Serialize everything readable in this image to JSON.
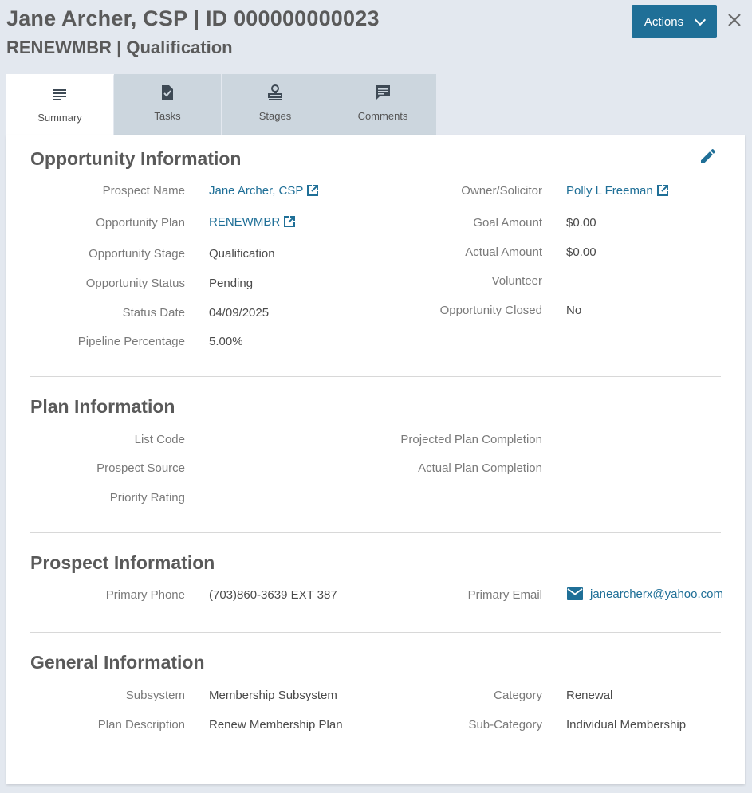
{
  "header": {
    "title": "Jane Archer, CSP | ID 000000000023",
    "subtitle": "RENEWMBR | Qualification",
    "actions_label": "Actions",
    "close_icon": "close-icon"
  },
  "tabs": [
    {
      "label": "Summary",
      "icon": "list-icon",
      "active": true
    },
    {
      "label": "Tasks",
      "icon": "task-check-icon",
      "active": false
    },
    {
      "label": "Stages",
      "icon": "stamp-icon",
      "active": false
    },
    {
      "label": "Comments",
      "icon": "comment-icon",
      "active": false
    }
  ],
  "opportunity": {
    "title": "Opportunity Information",
    "edit_icon": "pencil-icon",
    "left": [
      {
        "label": "Prospect Name",
        "value": "Jane Archer, CSP",
        "link": true
      },
      {
        "label": "Opportunity Plan",
        "value": "RENEWMBR",
        "link": true
      },
      {
        "label": "Opportunity Stage",
        "value": "Qualification"
      },
      {
        "label": "Opportunity Status",
        "value": "Pending"
      },
      {
        "label": "Status Date",
        "value": "04/09/2025"
      },
      {
        "label": "Pipeline Percentage",
        "value": "5.00%"
      }
    ],
    "right": [
      {
        "label": "Owner/Solicitor",
        "value": "Polly L Freeman",
        "link": true
      },
      {
        "label": "Goal Amount",
        "value": "$0.00"
      },
      {
        "label": "Actual Amount",
        "value": "$0.00"
      },
      {
        "label": "Volunteer",
        "value": ""
      },
      {
        "label": "Opportunity Closed",
        "value": "No"
      }
    ]
  },
  "plan": {
    "title": "Plan Information",
    "left": [
      {
        "label": "List Code",
        "value": ""
      },
      {
        "label": "Prospect Source",
        "value": ""
      },
      {
        "label": "Priority Rating",
        "value": ""
      }
    ],
    "right": [
      {
        "label": "Projected Plan Completion",
        "value": ""
      },
      {
        "label": "Actual Plan Completion",
        "value": ""
      }
    ]
  },
  "prospect": {
    "title": "Prospect Information",
    "phone_label": "Primary Phone",
    "phone_value": "(703)860-3639 EXT 387",
    "email_label": "Primary Email",
    "email_value": "janearcherx@yahoo.com"
  },
  "general": {
    "title": "General Information",
    "left": [
      {
        "label": "Subsystem",
        "value": "Membership Subsystem"
      },
      {
        "label": "Plan Description",
        "value": "Renew Membership Plan"
      }
    ],
    "right": [
      {
        "label": "Category",
        "value": "Renewal"
      },
      {
        "label": "Sub-Category",
        "value": "Individual Membership"
      }
    ]
  },
  "colors": {
    "accent": "#1f6f97",
    "background": "#e3e8ef",
    "tab_inactive": "#ccd6de"
  }
}
